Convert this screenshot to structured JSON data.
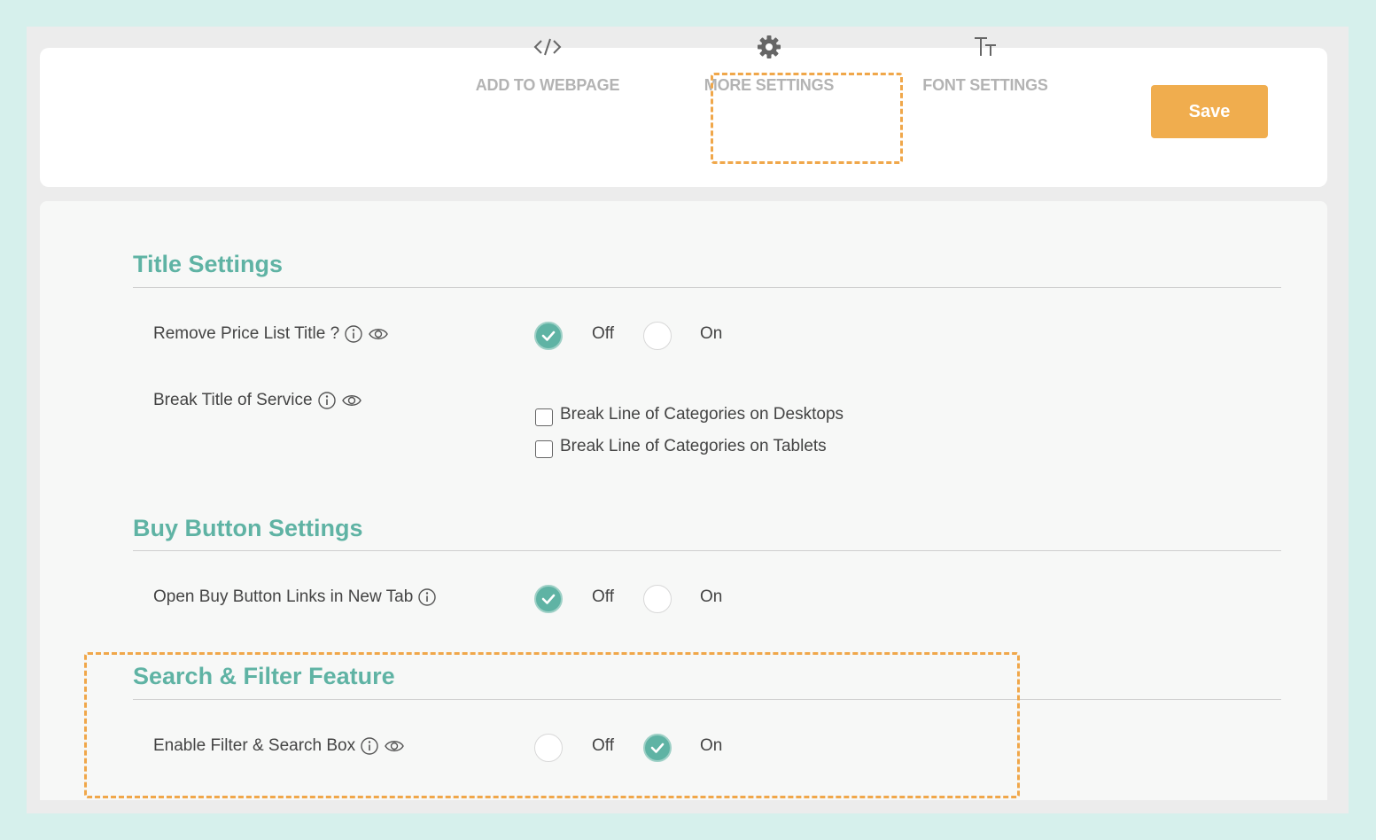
{
  "toolbar": {
    "tabs": [
      {
        "label": "ADD TO WEBPAGE",
        "icon": "code-icon"
      },
      {
        "label": "MORE SETTINGS",
        "icon": "gear-icon"
      },
      {
        "label": "FONT SETTINGS",
        "icon": "text-size-icon"
      }
    ],
    "save_label": "Save"
  },
  "colors": {
    "accent": "#5fb3a4",
    "save": "#f0ad4e",
    "highlight": "#f0a74a",
    "background": "#d6f0ec"
  },
  "sections": {
    "title_settings": {
      "heading": "Title Settings",
      "remove_title": {
        "label": "Remove Price List Title ?",
        "off": "Off",
        "on": "On",
        "selected": "Off"
      },
      "break_title": {
        "label": "Break Title of Service",
        "options": [
          {
            "label": "Break Line of Categories on Desktops",
            "checked": false
          },
          {
            "label": "Break Line of Categories on Tablets",
            "checked": false
          }
        ]
      }
    },
    "buy_button": {
      "heading": "Buy Button Settings",
      "new_tab": {
        "label": "Open Buy Button Links in New Tab",
        "off": "Off",
        "on": "On",
        "selected": "Off"
      }
    },
    "search_filter": {
      "heading": "Search & Filter Feature",
      "enable": {
        "label": "Enable Filter & Search Box",
        "off": "Off",
        "on": "On",
        "selected": "On"
      }
    }
  }
}
